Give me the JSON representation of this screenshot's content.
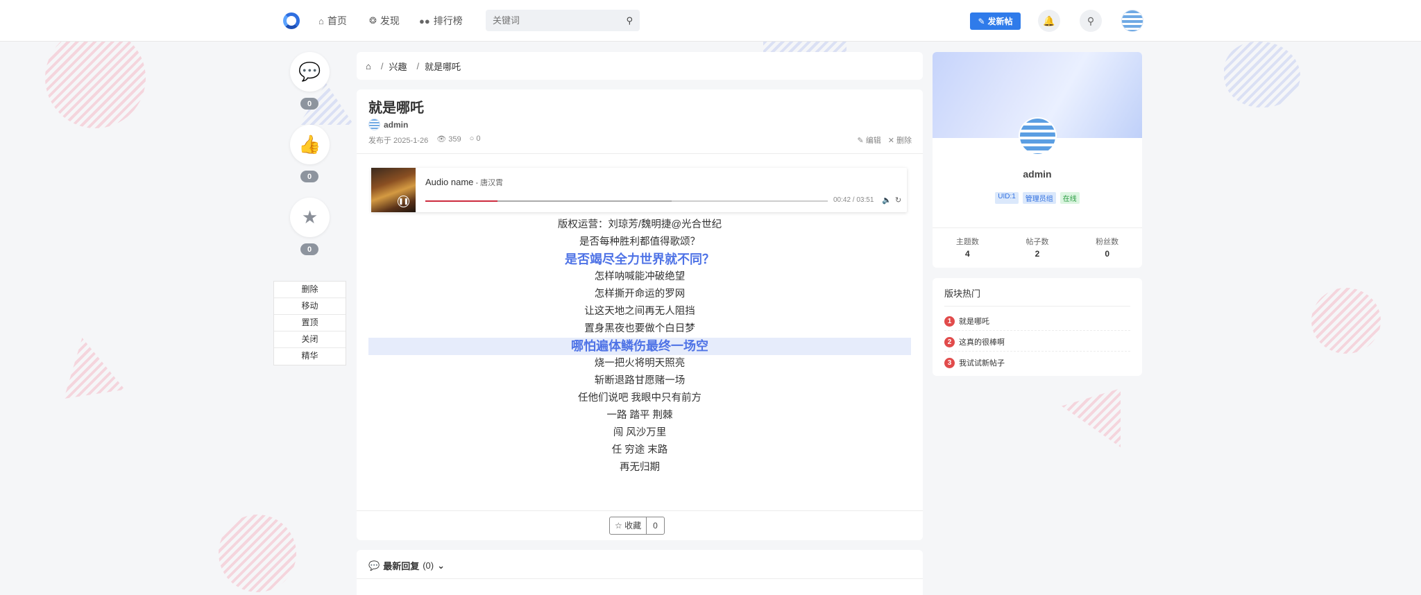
{
  "nav": {
    "items": [
      {
        "label": "首页",
        "icon": "home-icon"
      },
      {
        "label": "发现",
        "icon": "compass-icon"
      },
      {
        "label": "排行榜",
        "icon": "users-icon"
      }
    ],
    "search_placeholder": "关键词",
    "new_post_label": "发新帖"
  },
  "actions": {
    "comment_count": "0",
    "like_count": "0",
    "star_count": "0",
    "moderation": [
      "删除",
      "移动",
      "置顶",
      "关闭",
      "精华"
    ]
  },
  "breadcrumb": {
    "items": [
      "兴趣",
      "就是哪吒"
    ]
  },
  "post": {
    "title": "就是哪吒",
    "author": "admin",
    "published_label": "发布于 2025-1-26",
    "views": "359",
    "comments": "0",
    "edit_label": "编辑",
    "delete_label": "删除",
    "favorite_label": "收藏",
    "favorite_count": "0"
  },
  "player": {
    "audio_name": "Audio name",
    "artist": " - 唐汉霄",
    "time": "00:42 / 03:51",
    "progress": 0.18
  },
  "lyrics": [
    {
      "text": "版权运营：刘琼芳/魏明捷@光合世纪",
      "state": ""
    },
    {
      "text": "是否每种胜利都值得歌颂？",
      "state": ""
    },
    {
      "text": "是否竭尽全力世界就不同？",
      "state": "active"
    },
    {
      "text": "怎样呐喊能冲破绝望",
      "state": ""
    },
    {
      "text": "怎样撕开命运的罗网",
      "state": ""
    },
    {
      "text": "让这天地之间再无人阻挡",
      "state": ""
    },
    {
      "text": "置身黑夜也要做个白日梦",
      "state": ""
    },
    {
      "text": "哪怕遍体鳞伤最终一场空",
      "state": "active highlight"
    },
    {
      "text": "烧一把火将明天照亮",
      "state": ""
    },
    {
      "text": "斩断退路甘愿赌一场",
      "state": ""
    },
    {
      "text": "任他们说吧 我眼中只有前方",
      "state": ""
    },
    {
      "text": "一路 踏平 荆棘",
      "state": ""
    },
    {
      "text": "闯 风沙万里",
      "state": ""
    },
    {
      "text": "任 穷途 末路",
      "state": ""
    },
    {
      "text": "再无归期",
      "state": ""
    }
  ],
  "replies": {
    "label": "最新回复",
    "count": "(0)"
  },
  "profile": {
    "name": "admin",
    "badges": [
      "UID:1",
      "管理员组",
      "在线"
    ],
    "stats": [
      {
        "label": "主题数",
        "value": "4"
      },
      {
        "label": "帖子数",
        "value": "2"
      },
      {
        "label": "粉丝数",
        "value": "0"
      }
    ]
  },
  "hot": {
    "title": "版块热门",
    "items": [
      {
        "rank": "1",
        "label": "就是哪吒"
      },
      {
        "rank": "2",
        "label": "这真的很棒啊"
      },
      {
        "rank": "3",
        "label": "我试试新帖子"
      }
    ]
  },
  "colors": {
    "accent": "#2f7bea",
    "lyric_active": "#4f73e6",
    "rank_badge": "#e14b4b"
  }
}
